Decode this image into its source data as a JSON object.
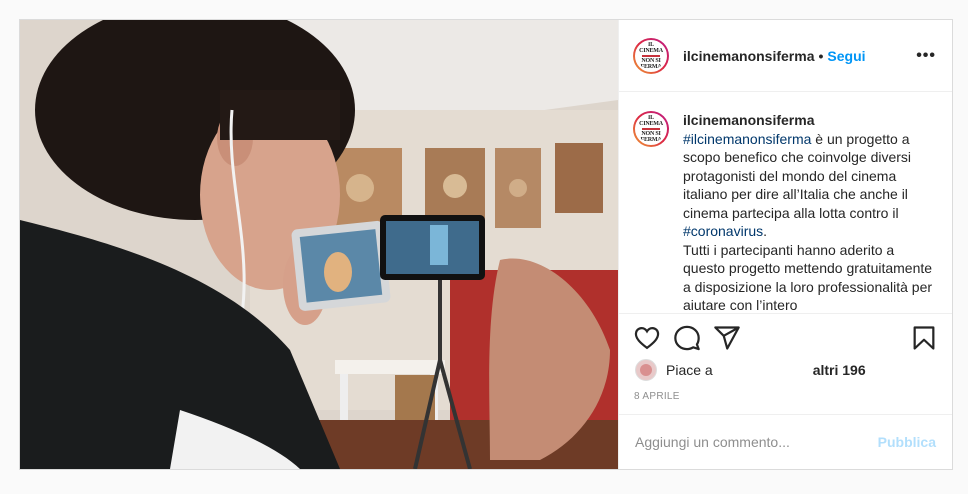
{
  "post": {
    "username": "ilcinemanonsiferma",
    "follow_label": "Segui",
    "more_label": "•••",
    "logo_line1": "IL CINEMA",
    "logo_line2": "NON SI",
    "logo_line3": "FERMA"
  },
  "caption": {
    "username": "ilcinemanonsiferma",
    "hashtag1": "#ilcinemanonsiferma",
    "text1": " è un progetto a scopo benefico che coinvolge diversi protagonisti del mondo del cinema italiano per dire all’Italia che anche il cinema partecipa alla lotta contro il ",
    "hashtag2": "#coronavirus",
    "text2": ".",
    "text3": "Tutti i partecipanti hanno aderito a questo progetto mettendo gratuitamente a disposizione la loro professionalità per aiutare con l’intero"
  },
  "likes": {
    "prefix": "Piace a",
    "others": "altri 196"
  },
  "date": "8 APRILE",
  "comment": {
    "placeholder": "Aggiungi un commento...",
    "publish_label": "Pubblica"
  },
  "icons": {
    "like": "heart-icon",
    "comment": "comment-icon",
    "share": "share-icon",
    "save": "bookmark-icon"
  }
}
